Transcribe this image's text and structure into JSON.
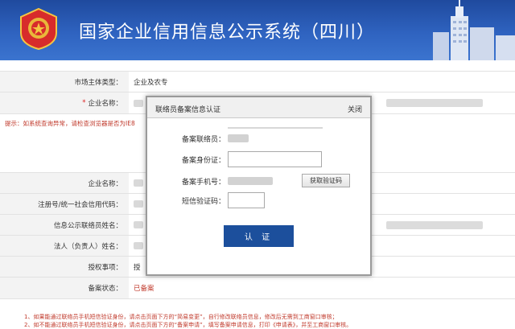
{
  "banner": {
    "title": "国家企业信用信息公示系统（四川）"
  },
  "top_form": {
    "market_type_label": "市场主体类型：",
    "market_type_value": "企业及农专",
    "company_name_label": "企业名称：",
    "required_mark": "*"
  },
  "tip": "提示：如系统查询异常，请检查浏览器是否为IE8",
  "bottom_form": {
    "company_name_label": "企业名称：",
    "reg_no_label": "注册号/统一社会信用代码：",
    "liaison_name_label": "信息公示联络员姓名：",
    "legal_rep_label": "法人（负责人）姓名：",
    "auth_label": "授权事项：",
    "auth_value_fragment": "授",
    "status_label": "备案状态：",
    "status_value": "已备案"
  },
  "modal": {
    "title": "联络员备案信息认证",
    "close": "关闭",
    "liaison_label": "备案联络员：",
    "id_label": "备案身份证：",
    "phone_label": "备案手机号：",
    "get_code_button": "获取验证码",
    "sms_label": "短信验证码：",
    "submit_button": "认 证"
  },
  "notes": {
    "line1": "1、如果能通过联络员手机短信验证身份，请点击页面下方的“简易变更”，自行修改联络员信息，修改后无需到工商窗口审核；",
    "line2": "2、如不能通过联络员手机短信验证身份，请点击页面下方的“备案申请”，填写备案申请信息，打印《申请表》，并至工商窗口审核。"
  },
  "colors": {
    "banner": "#2f63c0",
    "submit": "#1c4f9c",
    "warning": "#c0392b"
  }
}
